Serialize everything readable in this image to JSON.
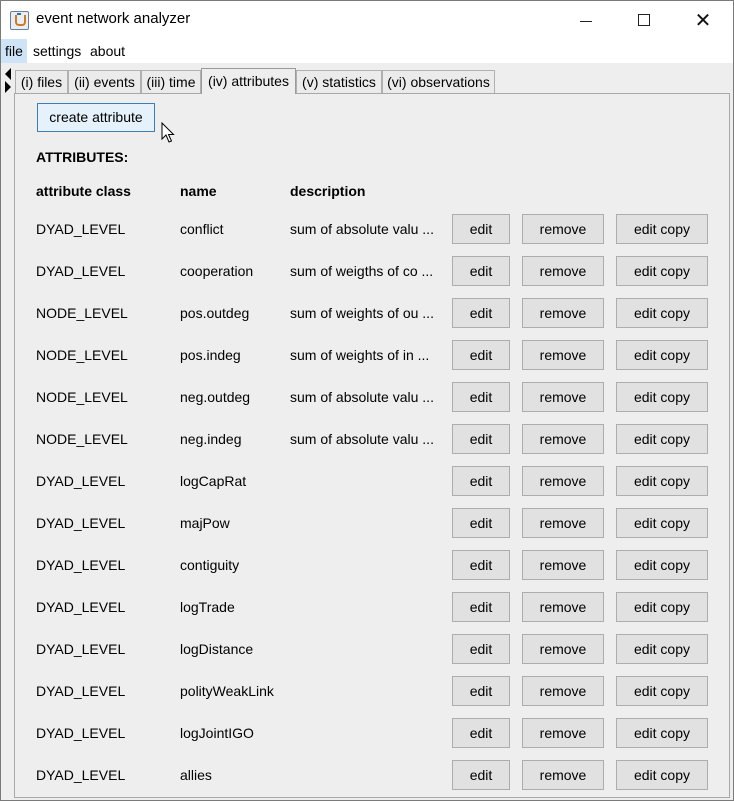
{
  "window": {
    "title": "event network analyzer",
    "icon": "java-cup-icon",
    "controls": {
      "minimize": "minimize-icon",
      "maximize": "maximize-icon",
      "close": "close-icon"
    }
  },
  "menu": {
    "items": [
      {
        "label": "file",
        "active": true
      },
      {
        "label": "settings",
        "active": false
      },
      {
        "label": "about",
        "active": false
      }
    ]
  },
  "tabs": [
    {
      "label": "(i) files",
      "active": false
    },
    {
      "label": "(ii) events",
      "active": false
    },
    {
      "label": "(iii) time",
      "active": false
    },
    {
      "label": "(iv) attributes",
      "active": true
    },
    {
      "label": "(v) statistics",
      "active": false
    },
    {
      "label": "(vi) observations",
      "active": false
    }
  ],
  "panel": {
    "create_button": "create attribute",
    "heading": "ATTRIBUTES:",
    "columns": {
      "class": "attribute class",
      "name": "name",
      "description": "description"
    },
    "button_labels": {
      "edit": "edit",
      "remove": "remove",
      "edit_copy": "edit copy"
    },
    "rows": [
      {
        "class": "DYAD_LEVEL",
        "name": "conflict",
        "description": "sum of absolute valu ..."
      },
      {
        "class": "DYAD_LEVEL",
        "name": "cooperation",
        "description": "sum of weigths of co ..."
      },
      {
        "class": "NODE_LEVEL",
        "name": "pos.outdeg",
        "description": "sum of weights of ou ..."
      },
      {
        "class": "NODE_LEVEL",
        "name": "pos.indeg",
        "description": "sum of weights of in ..."
      },
      {
        "class": "NODE_LEVEL",
        "name": "neg.outdeg",
        "description": "sum of absolute valu ..."
      },
      {
        "class": "NODE_LEVEL",
        "name": "neg.indeg",
        "description": "sum of absolute valu ..."
      },
      {
        "class": "DYAD_LEVEL",
        "name": "logCapRat",
        "description": ""
      },
      {
        "class": "DYAD_LEVEL",
        "name": "majPow",
        "description": ""
      },
      {
        "class": "DYAD_LEVEL",
        "name": "contiguity",
        "description": ""
      },
      {
        "class": "DYAD_LEVEL",
        "name": "logTrade",
        "description": ""
      },
      {
        "class": "DYAD_LEVEL",
        "name": "logDistance",
        "description": ""
      },
      {
        "class": "DYAD_LEVEL",
        "name": "polityWeakLink",
        "description": ""
      },
      {
        "class": "DYAD_LEVEL",
        "name": "logJointIGO",
        "description": ""
      },
      {
        "class": "DYAD_LEVEL",
        "name": "allies",
        "description": ""
      }
    ]
  },
  "colors": {
    "title_bg": "#ffffff",
    "window_bg": "#eeeeee",
    "menu_highlight": "#cfe3f6",
    "button_bg": "#e1e1e1",
    "focused_button_bg": "#e5f1fb",
    "focused_button_border": "#3c7fb1"
  }
}
